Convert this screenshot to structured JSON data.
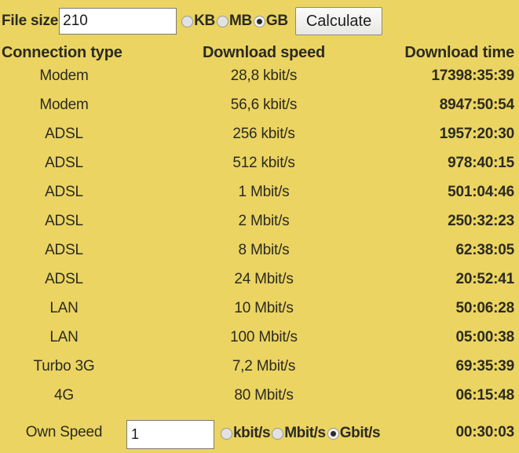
{
  "background_color": "#ebd462",
  "filesize": {
    "label": "File size",
    "value": "210",
    "placeholder": "",
    "units": [
      {
        "label": "KB",
        "selected": false
      },
      {
        "label": "MB",
        "selected": false
      },
      {
        "label": "GB",
        "selected": true
      }
    ],
    "calculate_label": "Calculate"
  },
  "table": {
    "headers": {
      "type": "Connection type",
      "speed": "Download speed",
      "time": "Download time"
    },
    "rows": [
      {
        "type": "Modem",
        "speed": "28,8 kbit/s",
        "time": "17398:35:39"
      },
      {
        "type": "Modem",
        "speed": "56,6 kbit/s",
        "time": "8947:50:54"
      },
      {
        "type": "ADSL",
        "speed": "256 kbit/s",
        "time": "1957:20:30"
      },
      {
        "type": "ADSL",
        "speed": "512 kbit/s",
        "time": "978:40:15"
      },
      {
        "type": "ADSL",
        "speed": "1 Mbit/s",
        "time": "501:04:46"
      },
      {
        "type": "ADSL",
        "speed": "2 Mbit/s",
        "time": "250:32:23"
      },
      {
        "type": "ADSL",
        "speed": "8 Mbit/s",
        "time": "62:38:05"
      },
      {
        "type": "ADSL",
        "speed": "24 Mbit/s",
        "time": "20:52:41"
      },
      {
        "type": "LAN",
        "speed": "10 Mbit/s",
        "time": "50:06:28"
      },
      {
        "type": "LAN",
        "speed": "100 Mbit/s",
        "time": "05:00:38"
      },
      {
        "type": "Turbo 3G",
        "speed": "7,2 Mbit/s",
        "time": "69:35:39"
      },
      {
        "type": "4G",
        "speed": "80 Mbit/s",
        "time": "06:15:48"
      }
    ]
  },
  "own_speed": {
    "label": "Own Speed",
    "value": "1",
    "placeholder": "",
    "units": [
      {
        "label": "kbit/s",
        "selected": false
      },
      {
        "label": "Mbit/s",
        "selected": false
      },
      {
        "label": "Gbit/s",
        "selected": true
      }
    ],
    "time": "00:30:03"
  }
}
